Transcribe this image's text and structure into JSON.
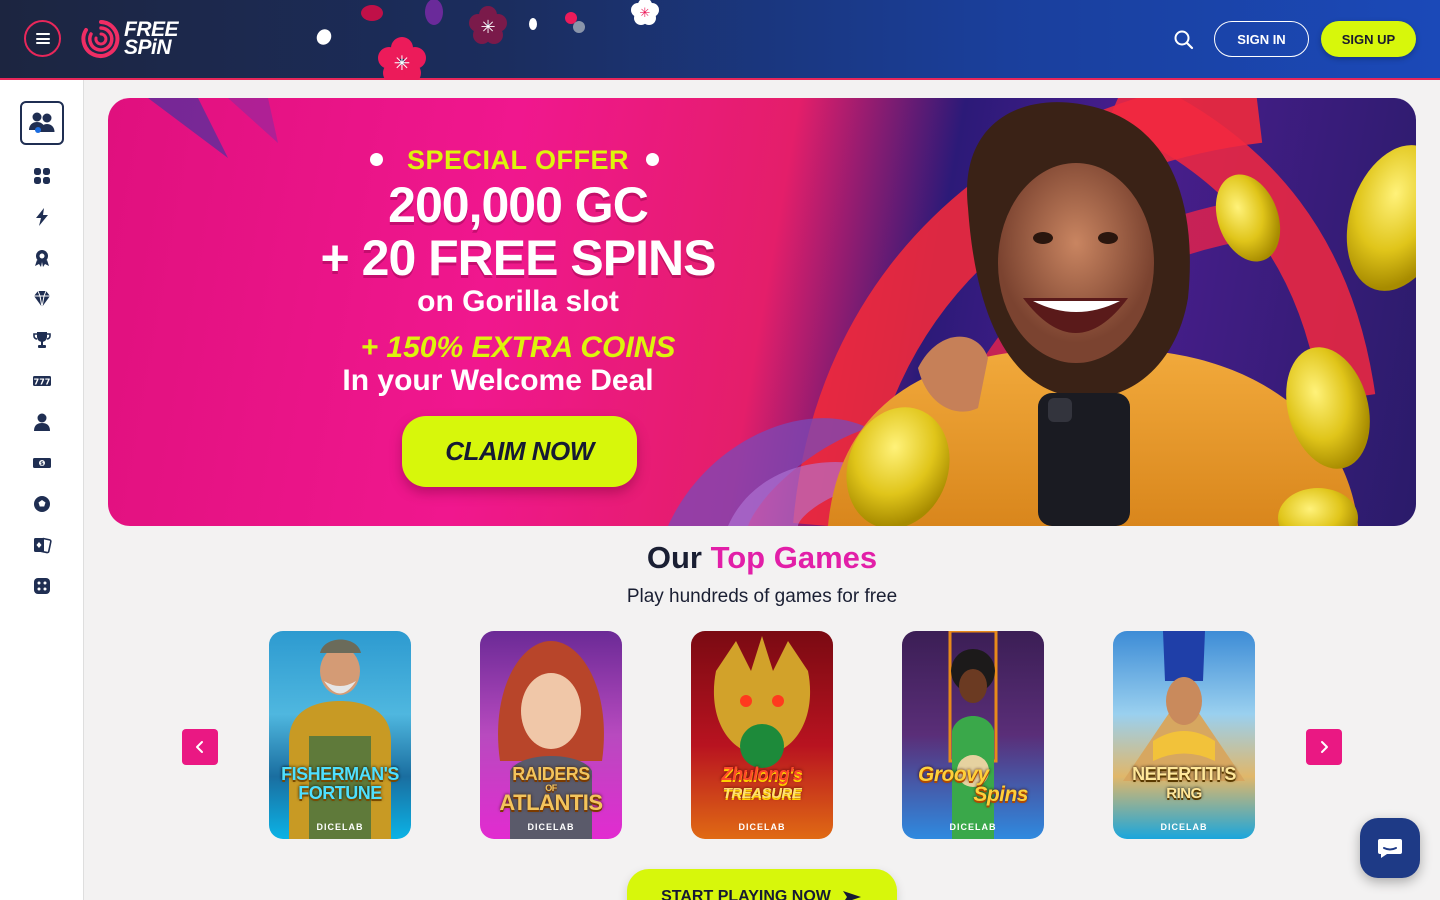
{
  "header": {
    "logo_line1": "FREE",
    "logo_line2": "SPiN",
    "signin_label": "SIGN IN",
    "signup_label": "SIGN UP"
  },
  "sidebar": {
    "items": [
      {
        "icon": "community-icon"
      },
      {
        "icon": "grid-icon"
      },
      {
        "icon": "lightning-icon"
      },
      {
        "icon": "ribbon-icon"
      },
      {
        "icon": "diamond-icon"
      },
      {
        "icon": "trophy-icon"
      },
      {
        "icon": "slots-777-icon"
      },
      {
        "icon": "user-icon"
      },
      {
        "icon": "cash-icon"
      },
      {
        "icon": "soccer-ball-icon"
      },
      {
        "icon": "cards-icon"
      },
      {
        "icon": "dice-icon"
      }
    ]
  },
  "banner": {
    "special_offer": "SPECIAL OFFER",
    "line1": "200,000 GC",
    "line2": "+ 20 FREE SPINS",
    "line3": "on Gorilla slot",
    "line4": "+ 150% EXTRA COINS",
    "line5": "In your Welcome Deal",
    "cta": "CLAIM NOW"
  },
  "section": {
    "title_part1": "Our",
    "title_part2": "Top Games",
    "subtitle": "Play hundreds of games for free"
  },
  "games": [
    {
      "name_line1": "FISHERMAN'S",
      "name_line2": "FORTUNE",
      "provider": "DICELAB"
    },
    {
      "name_line1": "RAIDERS",
      "name_line2": "ATLANTIS",
      "provider": "DICELAB",
      "small_word": "OF"
    },
    {
      "name_line1": "Zhulong's",
      "name_line2": "TREASURE",
      "provider": "DICELAB"
    },
    {
      "name_line1": "Groovy",
      "name_line2": "Spins",
      "provider": "DICELAB"
    },
    {
      "name_line1": "NEFERTITI'S",
      "name_line2": "RING",
      "provider": "DICELAB"
    }
  ],
  "start_cta": "START PLAYING NOW",
  "colors": {
    "accent_pink": "#e21fa8",
    "lime": "#d7f70b",
    "header_navy": "#1c2540",
    "header_blue": "#1b49b8"
  }
}
